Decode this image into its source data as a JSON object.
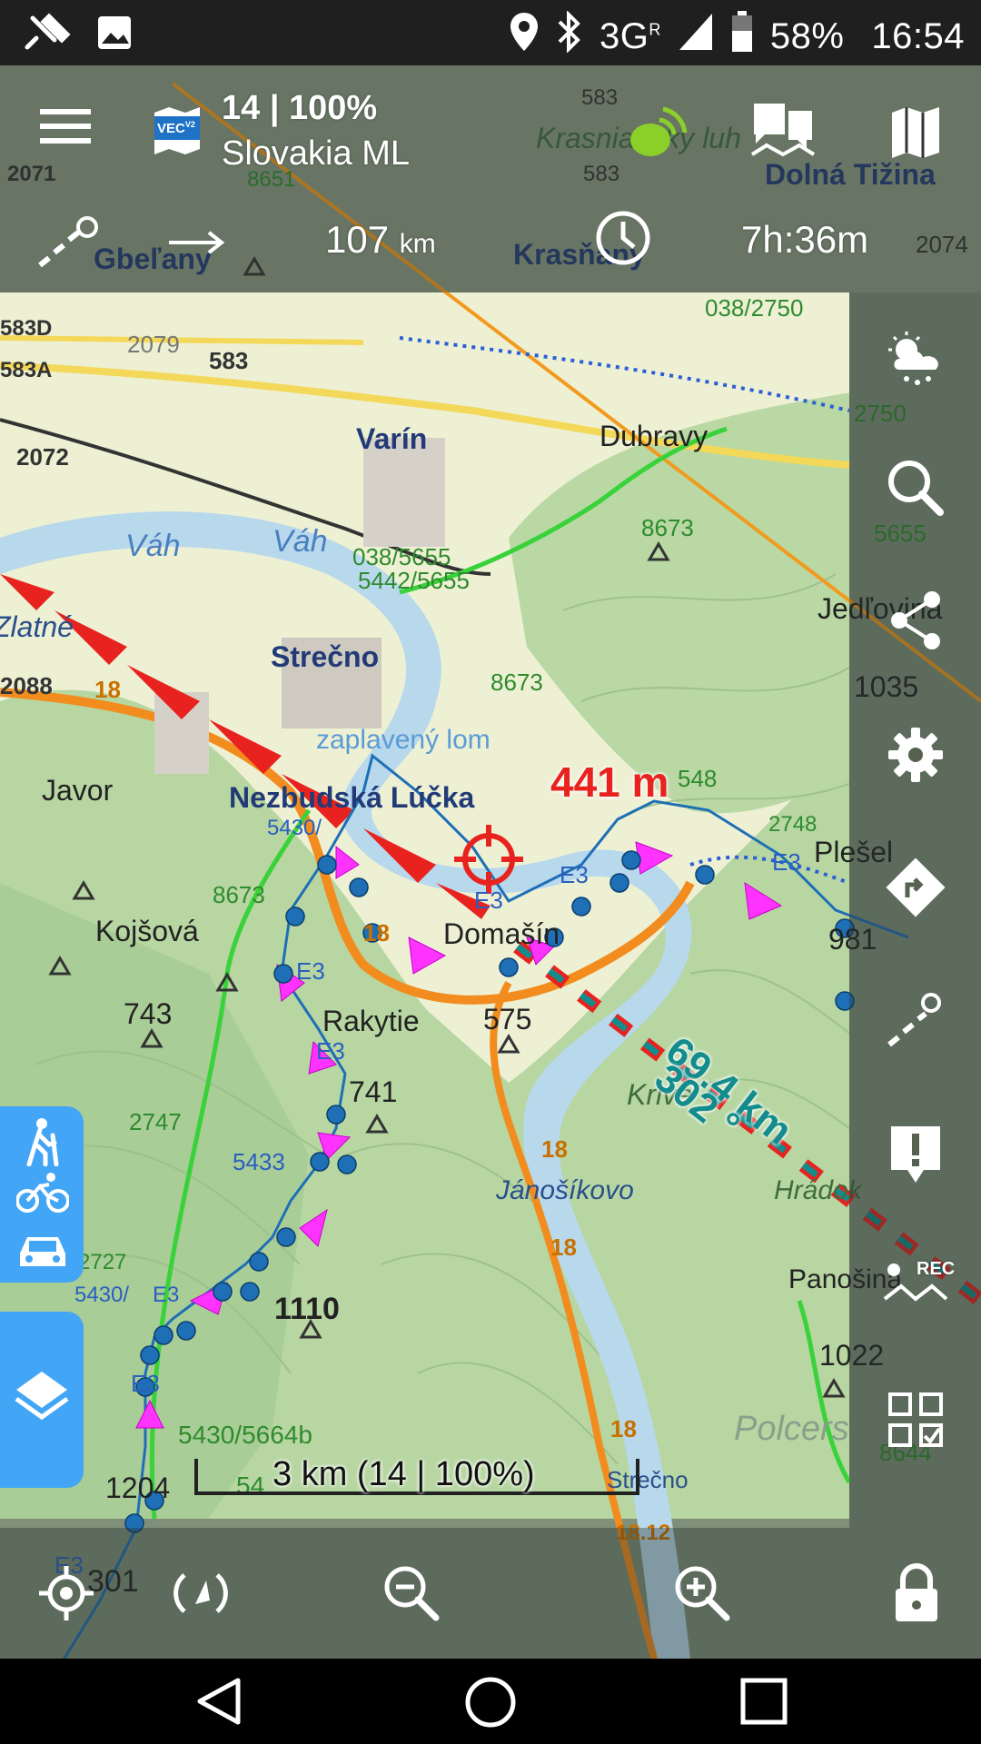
{
  "status_bar": {
    "network": "3G",
    "network_sup": "R",
    "battery_percent": "58%",
    "time": "16:54",
    "icons": [
      "route-icon",
      "image-icon",
      "location-icon",
      "bluetooth-icon",
      "signal-icon",
      "battery-icon"
    ]
  },
  "top_bar": {
    "map_level": "14 | 100%",
    "map_name": "Slovakia ML",
    "map_badge": "VEC",
    "map_badge_sup": "V2",
    "distance_value": "107",
    "distance_unit": "km",
    "time_value": "7h:36m"
  },
  "map": {
    "place_labels": {
      "varin": "Varín",
      "strecno": "Strečno",
      "dubravy": "Dubravy",
      "jedlovina": "Jedľovina",
      "javor": "Javor",
      "nezbudska": "Nezbudská Lúčka",
      "kojsova": "Kojšová",
      "domasin": "Domašín",
      "rakytie": "Rakytie",
      "plesel": "Plešel",
      "krive": "Krivé",
      "janosikovo": "Jánošíkovo",
      "hradok": "Hrádok",
      "panosina": "Panošina",
      "dolna_tizina": "Dolná Tižina",
      "gbelany": "Gbeľany",
      "krasnany": "Krasňany",
      "krasniansky_luh": "Krasniansky luh",
      "vah1": "Váh",
      "vah2": "Váh",
      "zaplaveny_lom": "zaplavený lom",
      "strecno_bottom": "Strečno",
      "zlatne": "Zlatné",
      "polcers": "Polcers"
    },
    "numbers": {
      "n583_top": "583",
      "n583_mid": "583",
      "n2071": "2071",
      "n8651": "8651",
      "n2074": "2074",
      "n583d": "583D",
      "n583a": "583A",
      "n2079": "2079",
      "n583_b": "583",
      "n2072": "2072",
      "n038_2750": "038/2750",
      "n2750": "2750",
      "n038_5655": "038/5655",
      "n5442_5655": "5442/5655",
      "n8673_a": "8673",
      "n8673_b": "8673",
      "n8673_c": "8673",
      "n5655": "5655",
      "n2088": "2088",
      "n18_a": "18",
      "n18_b": "18",
      "n18_c": "18",
      "n18_d": "18",
      "n18_e": "18",
      "n1812": "18.12",
      "n1035": "1035",
      "n5430a": "5430/",
      "n2748": "2748",
      "n981": "981",
      "n743": "743",
      "n575": "575",
      "n741": "741",
      "n2747": "2747",
      "n5430b": "5430/",
      "n1110": "1110",
      "n1022": "1022",
      "n5430_5664b": "5430/5664b",
      "n1204": "1204",
      "n301": "301",
      "n2727": "2727",
      "n8644": "8644",
      "e3_a": "E3",
      "e3_b": "E3",
      "e3_c": "E3",
      "e3_d": "E3",
      "e3_e": "E3",
      "e3_f": "E3",
      "e3_g": "E3",
      "e3_h": "E3",
      "n548": "548",
      "n5433": "5433",
      "n54": "54"
    },
    "cursor_distance": "441 m",
    "target_distance": "69.4 km",
    "target_bearing": "302 °",
    "scale_label": "3 km (14 | 100%)"
  },
  "colors": {
    "route_magenta": "#ff33ff",
    "track_point": "#1e6fb5",
    "cursor_red": "#e8231f",
    "guide_teal": "#128c8c",
    "road_orange": "#f28c1e",
    "river": "#b8d8ec",
    "forest": "#b9d7a4",
    "accent_blue": "#42a5f5"
  },
  "side_panel": {
    "buttons": [
      "weather-icon",
      "search-icon",
      "share-icon",
      "settings-icon",
      "navigation-icon",
      "route-planner-icon",
      "alert-icon",
      "track-recording-icon",
      "qr-checklist-icon"
    ],
    "rec_label": "REC"
  },
  "bottom_bar": {
    "buttons": [
      "my-location-icon",
      "rotate-map-icon",
      "zoom-out-icon",
      "zoom-in-icon",
      "lock-icon"
    ]
  },
  "left_tabs": {
    "profile_icons": [
      "hiking-icon",
      "bicycle-icon",
      "car-icon"
    ],
    "layers_icon": "layers-icon"
  }
}
